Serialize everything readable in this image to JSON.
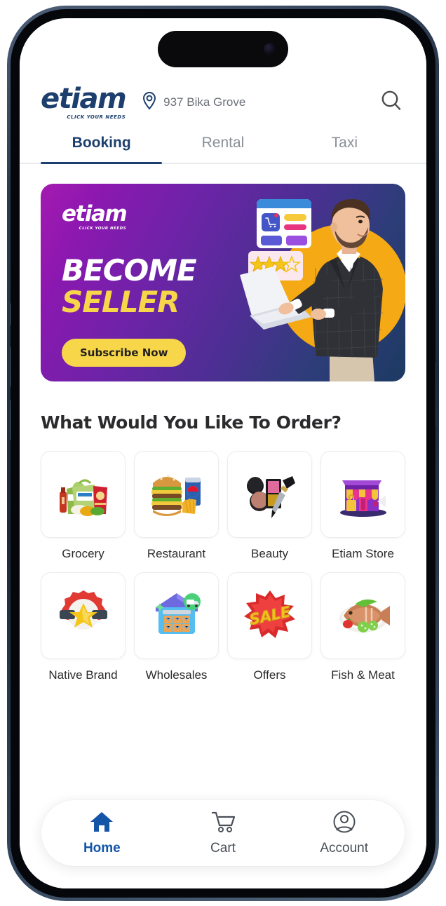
{
  "app": {
    "brand": {
      "name": "etiam",
      "tagline": "CLICK YOUR NEEDS"
    },
    "header": {
      "location_label": "937 Bika Grove",
      "location_icon": "map-pin-icon",
      "search_icon": "search-icon"
    },
    "tabs": [
      {
        "label": "Booking",
        "active": true
      },
      {
        "label": "Rental",
        "active": false
      },
      {
        "label": "Taxi",
        "active": false
      }
    ],
    "banner": {
      "brand": "etiam",
      "tagline": "CLICK YOUR NEEDS",
      "headline_line1": "BECOME",
      "headline_line2": "SELLER",
      "cta_label": "Subscribe Now",
      "illustration": "businessman-with-laptop-illustration",
      "rating_stars": 4,
      "colors": {
        "gradient_start": "#a41ab0",
        "gradient_end": "#1d3a62",
        "accent_yellow": "#f7d64a",
        "circle_orange": "#f5a914"
      }
    },
    "section": {
      "title": "What Would You Like To Order?"
    },
    "categories": [
      {
        "label": "Grocery",
        "icon": "grocery-bags-icon"
      },
      {
        "label": "Restaurant",
        "icon": "burger-meal-icon"
      },
      {
        "label": "Beauty",
        "icon": "makeup-palette-icon"
      },
      {
        "label": "Etiam Store",
        "icon": "storefront-icon"
      },
      {
        "label": "Native Brand",
        "icon": "star-badge-icon"
      },
      {
        "label": "Wholesales",
        "icon": "warehouse-icon"
      },
      {
        "label": "Offers",
        "icon": "sale-burst-icon"
      },
      {
        "label": "Fish & Meat",
        "icon": "fish-plate-icon"
      }
    ],
    "bottom_nav": [
      {
        "label": "Home",
        "icon": "home-icon",
        "active": true
      },
      {
        "label": "Cart",
        "icon": "cart-icon",
        "active": false
      },
      {
        "label": "Account",
        "icon": "account-icon",
        "active": false
      }
    ],
    "colors": {
      "brand_navy": "#1d3f6e",
      "nav_active": "#1455a8",
      "muted_text": "#8a8f97"
    }
  }
}
